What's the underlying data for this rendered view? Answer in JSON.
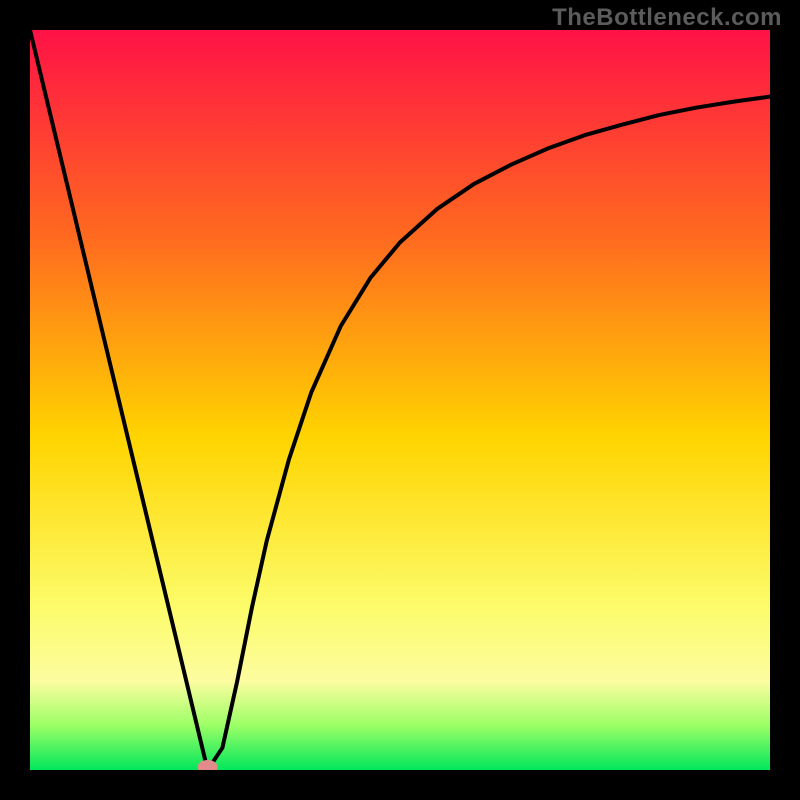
{
  "watermark": "TheBottleneck.com",
  "colors": {
    "top": "#ff1246",
    "upper_mid": "#ff7a1a",
    "mid": "#ffd400",
    "lower_mid": "#fcfc6a",
    "near_bottom": "#7dff66",
    "bottom": "#01e65c",
    "frame": "#000000",
    "marker": "#e38a8a",
    "curve": "#000000"
  },
  "chart_data": {
    "type": "line",
    "title": "",
    "xlabel": "",
    "ylabel": "",
    "xlim": [
      0,
      100
    ],
    "ylim": [
      0,
      100
    ],
    "series": [
      {
        "name": "curve",
        "x": [
          0,
          5,
          10,
          15,
          20,
          24,
          26,
          28,
          30,
          32,
          35,
          38,
          42,
          46,
          50,
          55,
          60,
          65,
          70,
          75,
          80,
          85,
          90,
          95,
          100
        ],
        "y": [
          100,
          79.2,
          58.3,
          37.5,
          16.7,
          0,
          3,
          12,
          22,
          31,
          42,
          51,
          60,
          66.5,
          71.3,
          75.8,
          79.2,
          81.8,
          84,
          85.8,
          87.2,
          88.5,
          89.5,
          90.3,
          91
        ]
      }
    ],
    "markers": [
      {
        "name": "bottom-dot",
        "x": 24,
        "y": 0
      }
    ],
    "legend": false,
    "grid": false
  }
}
